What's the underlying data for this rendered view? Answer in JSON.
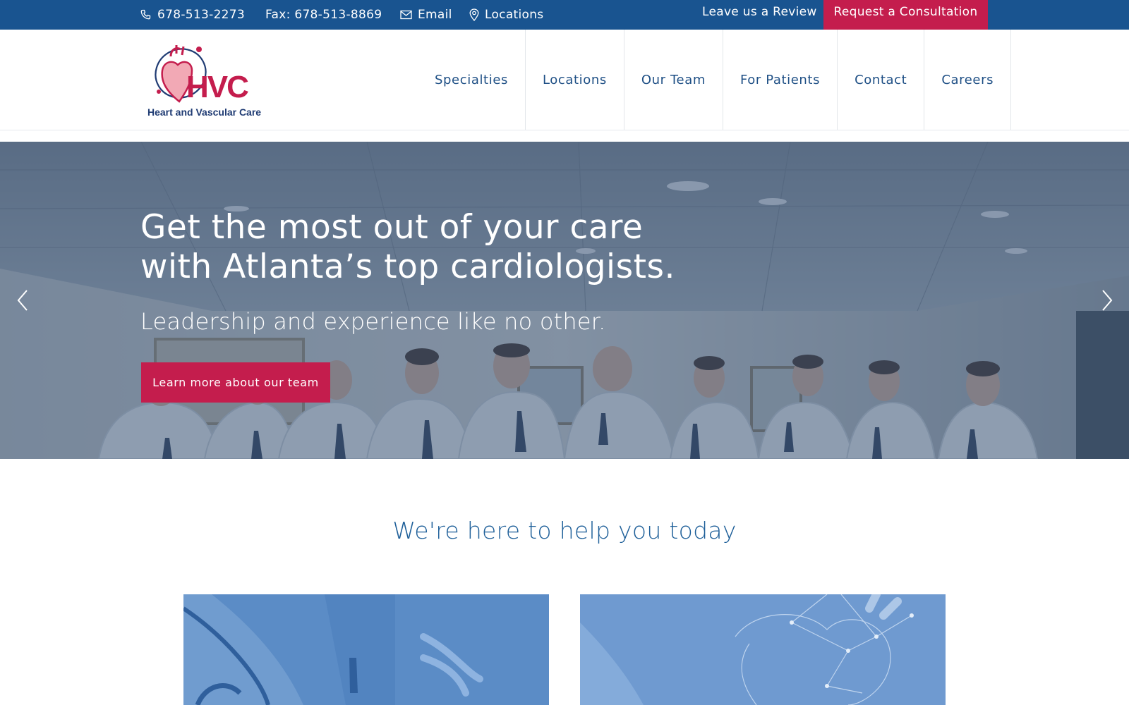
{
  "topbar": {
    "phone": "678-513-2273",
    "fax": "Fax: 678-513-8869",
    "email": "Email",
    "locations": "Locations",
    "review": "Leave us a Review",
    "consultation": "Request a Consultation"
  },
  "logo": {
    "letters": "HVC",
    "tagline": "Heart and Vascular Care"
  },
  "nav": {
    "items": [
      "Specialties",
      "Locations",
      "Our Team",
      "For Patients",
      "Contact",
      "Careers"
    ]
  },
  "hero": {
    "title_line1": "Get the most out of your care",
    "title_line2": "with Atlanta’s top cardiologists.",
    "subtitle": "Leadership and experience like no other.",
    "button": "Learn more about our team"
  },
  "section": {
    "title": "We're here to help you today"
  },
  "colors": {
    "brand_blue": "#195490",
    "brand_red": "#c41d4d",
    "nav_text": "#1e4f85",
    "hero_overlay": "#3a5476"
  },
  "icons": [
    "phone-icon",
    "envelope-icon",
    "map-pin-icon",
    "chevron-left-icon",
    "chevron-right-icon"
  ]
}
